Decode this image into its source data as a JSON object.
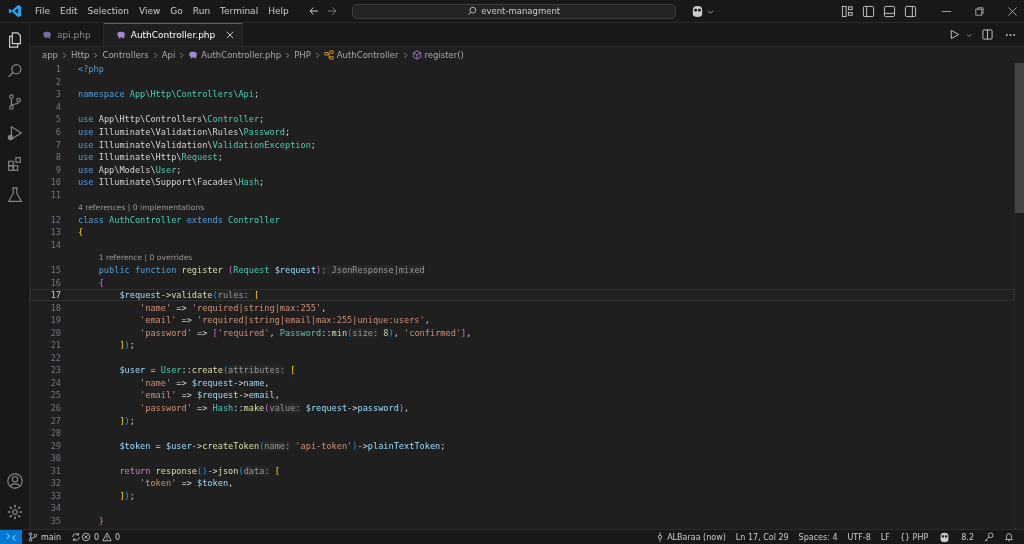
{
  "menu": [
    "File",
    "Edit",
    "Selection",
    "View",
    "Go",
    "Run",
    "Terminal",
    "Help"
  ],
  "search": {
    "value": "event-managment"
  },
  "tabs": [
    {
      "label": "api.php",
      "selected": false
    },
    {
      "label": "AuthController.php",
      "selected": true
    }
  ],
  "breadcrumbs": [
    {
      "label": "app",
      "kind": "folder"
    },
    {
      "label": "Http",
      "kind": "folder"
    },
    {
      "label": "Controllers",
      "kind": "folder"
    },
    {
      "label": "Api",
      "kind": "folder"
    },
    {
      "label": "AuthController.php",
      "kind": "file"
    },
    {
      "label": "PHP",
      "kind": "folder"
    },
    {
      "label": "AuthController",
      "kind": "class"
    },
    {
      "label": "register()",
      "kind": "method"
    }
  ],
  "lines": [
    {
      "n": "1",
      "active": false,
      "tokens": [
        {
          "text": "<?php",
          "kind": "kw"
        }
      ]
    },
    {
      "n": "2",
      "active": false
    },
    {
      "n": "3",
      "active": false,
      "tokens": [
        {
          "text": "namespace ",
          "kind": "kw"
        },
        {
          "text": "App\\Http\\Controllers\\Api",
          "kind": "type"
        },
        {
          "text": ";",
          "kind": "plain"
        }
      ]
    },
    {
      "n": "4",
      "active": false
    },
    {
      "n": "5",
      "active": false,
      "tokens": [
        {
          "text": "use ",
          "kind": "kw"
        },
        {
          "text": "App\\Http\\Controllers\\",
          "kind": "plain"
        },
        {
          "text": "Controller",
          "kind": "type"
        },
        {
          "text": ";",
          "kind": "plain"
        }
      ]
    },
    {
      "n": "6",
      "active": false,
      "tokens": [
        {
          "text": "use ",
          "kind": "kw"
        },
        {
          "text": "Illuminate\\Validation\\Rules\\",
          "kind": "plain"
        },
        {
          "text": "Password",
          "kind": "type"
        },
        {
          "text": ";",
          "kind": "plain"
        }
      ]
    },
    {
      "n": "7",
      "active": false,
      "tokens": [
        {
          "text": "use ",
          "kind": "kw"
        },
        {
          "text": "Illuminate\\Validation\\",
          "kind": "plain"
        },
        {
          "text": "ValidationException",
          "kind": "type"
        },
        {
          "text": ";",
          "kind": "plain"
        }
      ]
    },
    {
      "n": "8",
      "active": false,
      "tokens": [
        {
          "text": "use ",
          "kind": "kw"
        },
        {
          "text": "Illuminate\\Http\\",
          "kind": "plain"
        },
        {
          "text": "Request",
          "kind": "type"
        },
        {
          "text": ";",
          "kind": "plain"
        }
      ]
    },
    {
      "n": "9",
      "active": false,
      "tokens": [
        {
          "text": "use ",
          "kind": "kw"
        },
        {
          "text": "App\\Models\\",
          "kind": "plain"
        },
        {
          "text": "User",
          "kind": "type"
        },
        {
          "text": ";",
          "kind": "plain"
        }
      ]
    },
    {
      "n": "10",
      "active": false,
      "tokens": [
        {
          "text": "use ",
          "kind": "kw"
        },
        {
          "text": "Illuminate\\Support\\Facades\\",
          "kind": "plain"
        },
        {
          "text": "Hash",
          "kind": "type"
        },
        {
          "text": ";",
          "kind": "plain"
        }
      ]
    },
    {
      "n": "11",
      "active": false
    },
    {
      "n": "12",
      "active": false,
      "lens": "4 references | 0 implementations",
      "tokens": [
        {
          "text": "class ",
          "kind": "kw"
        },
        {
          "text": "AuthController ",
          "kind": "type"
        },
        {
          "text": "extends ",
          "kind": "kw"
        },
        {
          "text": "Controller",
          "kind": "type"
        }
      ]
    },
    {
      "n": "13",
      "active": false,
      "tokens": [
        {
          "text": "{",
          "kind": "b1"
        }
      ]
    },
    {
      "n": "14",
      "active": false
    },
    {
      "n": "15",
      "active": false,
      "lens": "1 reference | 0 overrides",
      "tokens": [
        {
          "text": "    public ",
          "kind": "kw"
        },
        {
          "text": "function ",
          "kind": "kw"
        },
        {
          "text": "register ",
          "kind": "fn"
        },
        {
          "text": "(",
          "kind": "b2"
        },
        {
          "text": "Request ",
          "kind": "type"
        },
        {
          "text": "$request",
          "kind": "var"
        },
        {
          "text": ")",
          "kind": "b2"
        },
        {
          "text": ": JsonResponse|mixed",
          "kind": "hint"
        }
      ]
    },
    {
      "n": "16",
      "active": false,
      "tokens": [
        {
          "text": "    {",
          "kind": "b2"
        }
      ]
    },
    {
      "n": "17",
      "active": true,
      "tokens": [
        {
          "text": "        $request",
          "kind": "var"
        },
        {
          "text": "->",
          "kind": "plain"
        },
        {
          "text": "validate",
          "kind": "fn"
        },
        {
          "text": "(",
          "kind": "b3"
        },
        {
          "text": "rules:",
          "kind": "hint"
        },
        {
          "text": " [",
          "kind": "b1"
        }
      ]
    },
    {
      "n": "18",
      "active": false,
      "tokens": [
        {
          "text": "            'name'",
          "kind": "str"
        },
        {
          "text": " => ",
          "kind": "plain"
        },
        {
          "text": "'required|string|max:255'",
          "kind": "str"
        },
        {
          "text": ",",
          "kind": "plain"
        }
      ]
    },
    {
      "n": "19",
      "active": false,
      "tokens": [
        {
          "text": "            'email'",
          "kind": "str"
        },
        {
          "text": " => ",
          "kind": "plain"
        },
        {
          "text": "'required|string|email|max:255|unique:users'",
          "kind": "str"
        },
        {
          "text": ",",
          "kind": "plain"
        }
      ]
    },
    {
      "n": "20",
      "active": false,
      "tokens": [
        {
          "text": "            'password'",
          "kind": "str"
        },
        {
          "text": " => ",
          "kind": "plain"
        },
        {
          "text": "[",
          "kind": "b2"
        },
        {
          "text": "'required'",
          "kind": "str"
        },
        {
          "text": ", ",
          "kind": "plain"
        },
        {
          "text": "Password",
          "kind": "type"
        },
        {
          "text": "::",
          "kind": "plain"
        },
        {
          "text": "min",
          "kind": "fn"
        },
        {
          "text": "(",
          "kind": "b3"
        },
        {
          "text": "size:",
          "kind": "hint"
        },
        {
          "text": " 8",
          "kind": "num"
        },
        {
          "text": ")",
          "kind": "b3"
        },
        {
          "text": ", ",
          "kind": "plain"
        },
        {
          "text": "'confirmed'",
          "kind": "str"
        },
        {
          "text": "]",
          "kind": "b2"
        },
        {
          "text": ",",
          "kind": "plain"
        }
      ]
    },
    {
      "n": "21",
      "active": false,
      "tokens": [
        {
          "text": "        ]",
          "kind": "b1"
        },
        {
          "text": ")",
          "kind": "b3"
        },
        {
          "text": ";",
          "kind": "plain"
        }
      ]
    },
    {
      "n": "22",
      "active": false
    },
    {
      "n": "23",
      "active": false,
      "tokens": [
        {
          "text": "        $user",
          "kind": "var"
        },
        {
          "text": " = ",
          "kind": "plain"
        },
        {
          "text": "User",
          "kind": "type"
        },
        {
          "text": "::",
          "kind": "plain"
        },
        {
          "text": "create",
          "kind": "fn"
        },
        {
          "text": "(",
          "kind": "b3"
        },
        {
          "text": "attributes:",
          "kind": "hint"
        },
        {
          "text": " [",
          "kind": "b1"
        }
      ]
    },
    {
      "n": "24",
      "active": false,
      "tokens": [
        {
          "text": "            'name'",
          "kind": "str"
        },
        {
          "text": " => ",
          "kind": "plain"
        },
        {
          "text": "$request",
          "kind": "var"
        },
        {
          "text": "->",
          "kind": "plain"
        },
        {
          "text": "name",
          "kind": "var"
        },
        {
          "text": ",",
          "kind": "plain"
        }
      ]
    },
    {
      "n": "25",
      "active": false,
      "tokens": [
        {
          "text": "            'email'",
          "kind": "str"
        },
        {
          "text": " => ",
          "kind": "plain"
        },
        {
          "text": "$request",
          "kind": "var"
        },
        {
          "text": "->",
          "kind": "plain"
        },
        {
          "text": "email",
          "kind": "var"
        },
        {
          "text": ",",
          "kind": "plain"
        }
      ]
    },
    {
      "n": "26",
      "active": false,
      "tokens": [
        {
          "text": "            'password'",
          "kind": "str"
        },
        {
          "text": " => ",
          "kind": "plain"
        },
        {
          "text": "Hash",
          "kind": "type"
        },
        {
          "text": "::",
          "kind": "plain"
        },
        {
          "text": "make",
          "kind": "fn"
        },
        {
          "text": "(",
          "kind": "b2"
        },
        {
          "text": "value:",
          "kind": "hint"
        },
        {
          "text": " $request",
          "kind": "var"
        },
        {
          "text": "->",
          "kind": "plain"
        },
        {
          "text": "password",
          "kind": "var"
        },
        {
          "text": ")",
          "kind": "b2"
        },
        {
          "text": ",",
          "kind": "plain"
        }
      ]
    },
    {
      "n": "27",
      "active": false,
      "tokens": [
        {
          "text": "        ]",
          "kind": "b1"
        },
        {
          "text": ")",
          "kind": "b3"
        },
        {
          "text": ";",
          "kind": "plain"
        }
      ]
    },
    {
      "n": "28",
      "active": false
    },
    {
      "n": "29",
      "active": false,
      "tokens": [
        {
          "text": "        $token",
          "kind": "var"
        },
        {
          "text": " = ",
          "kind": "plain"
        },
        {
          "text": "$user",
          "kind": "var"
        },
        {
          "text": "->",
          "kind": "plain"
        },
        {
          "text": "createToken",
          "kind": "fn"
        },
        {
          "text": "(",
          "kind": "b3"
        },
        {
          "text": "name:",
          "kind": "hint"
        },
        {
          "text": " 'api-token'",
          "kind": "str"
        },
        {
          "text": ")",
          "kind": "b3"
        },
        {
          "text": "->",
          "kind": "plain"
        },
        {
          "text": "plainTextToken",
          "kind": "var"
        },
        {
          "text": ";",
          "kind": "plain"
        }
      ]
    },
    {
      "n": "30",
      "active": false
    },
    {
      "n": "31",
      "active": false,
      "tokens": [
        {
          "text": "        return ",
          "kind": "ctl"
        },
        {
          "text": "response",
          "kind": "fn"
        },
        {
          "text": "()",
          "kind": "b3"
        },
        {
          "text": "->",
          "kind": "plain"
        },
        {
          "text": "json",
          "kind": "fn"
        },
        {
          "text": "(",
          "kind": "b3"
        },
        {
          "text": "data:",
          "kind": "hint"
        },
        {
          "text": " [",
          "kind": "b1"
        }
      ]
    },
    {
      "n": "32",
      "active": false,
      "tokens": [
        {
          "text": "            'token'",
          "kind": "str"
        },
        {
          "text": " => ",
          "kind": "plain"
        },
        {
          "text": "$token",
          "kind": "var"
        },
        {
          "text": ",",
          "kind": "plain"
        }
      ]
    },
    {
      "n": "33",
      "active": false,
      "tokens": [
        {
          "text": "        ]",
          "kind": "b1"
        },
        {
          "text": ")",
          "kind": "b3"
        },
        {
          "text": ";",
          "kind": "plain"
        }
      ]
    },
    {
      "n": "34",
      "active": false
    },
    {
      "n": "35",
      "active": false,
      "tokens": [
        {
          "text": "    }",
          "kind": "b2"
        }
      ]
    }
  ],
  "status_bar": {
    "branch": "main",
    "errors": "0",
    "warnings": "0",
    "author": "ALBaraa (now)",
    "position": "Ln 17, Col 29",
    "spaces": "Spaces: 4",
    "encoding": "UTF-8",
    "eol": "LF",
    "language_glyph": "{}",
    "language": "PHP",
    "version": "8.2"
  }
}
